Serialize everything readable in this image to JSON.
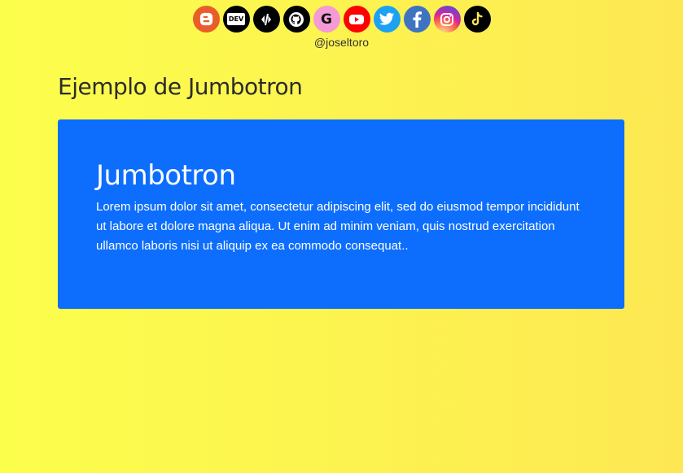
{
  "social": [
    {
      "name": "blogger",
      "color": "#e95d2b"
    },
    {
      "name": "dev",
      "label": "DEV",
      "color": "#000000"
    },
    {
      "name": "codepen",
      "color": "#000000"
    },
    {
      "name": "github",
      "color": "#000000"
    },
    {
      "name": "google",
      "label": "G",
      "color": "#f49ad4"
    },
    {
      "name": "youtube",
      "color": "#ff0000"
    },
    {
      "name": "twitter",
      "color": "#1da1f2"
    },
    {
      "name": "facebook",
      "color": "#3f73c2"
    },
    {
      "name": "instagram",
      "color": "#c13584"
    },
    {
      "name": "tiktok",
      "color": "#000000"
    }
  ],
  "handle": "@joseltoro",
  "page_title": "Ejemplo de Jumbotron",
  "jumbotron": {
    "title": "Jumbotron",
    "text": "Lorem ipsum dolor sit amet, consectetur adipiscing elit, sed do eiusmod tempor incididunt ut labore et dolore magna aliqua. Ut enim ad minim veniam, quis nostrud exercitation ullamco laboris nisi ut aliquip ex ea commodo consequat..",
    "bg_color": "#0d6efd"
  }
}
